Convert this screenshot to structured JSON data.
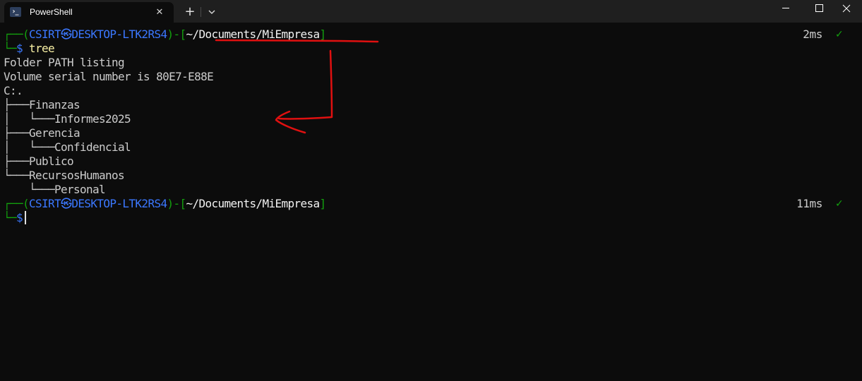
{
  "window": {
    "tab_title": "PowerShell",
    "tab_icon_glyph": "›_",
    "close_tab_glyph": "✕",
    "new_tab_glyph": "+",
    "controls": [
      "minimize",
      "maximize",
      "close"
    ]
  },
  "prompt": {
    "open_corner": "┌──(",
    "user": "CSIRT",
    "sep_symbol": "㉿",
    "host": "DESKTOP-LTK2RS4",
    "close_host": ")-[",
    "path": "~/Documents/MiEmpresa",
    "close_path": "]",
    "prompt_corner": "└─",
    "dollar": "$"
  },
  "commands": [
    {
      "text": "tree",
      "timing": "2ms",
      "status": "✓"
    },
    {
      "text": "",
      "timing": "11ms",
      "status": "✓"
    }
  ],
  "output": [
    "Folder PATH listing",
    "Volume serial number is 80E7-E88E",
    "C:.",
    "├───Finanzas",
    "│   └───Informes2025",
    "├───Gerencia",
    "│   └───Confidencial",
    "├───Publico",
    "└───RecursosHumanos",
    "    └───Personal"
  ],
  "colors": {
    "background": "#0c0c0c",
    "prompt_green": "#13a10e",
    "user_blue": "#3b78ff",
    "command_yellow": "#f9f1a5",
    "annotation_red": "#e01010"
  }
}
